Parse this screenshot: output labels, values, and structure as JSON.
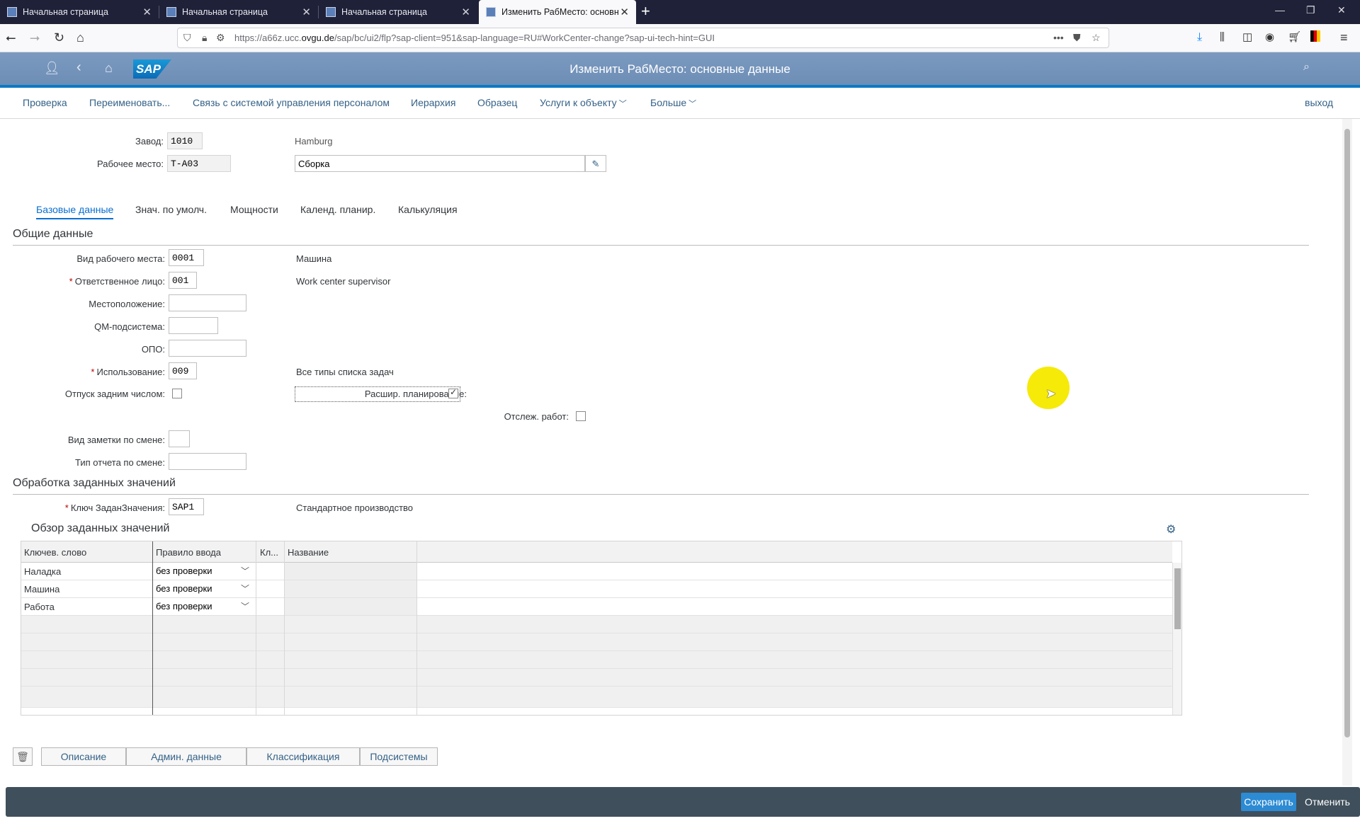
{
  "browser": {
    "tabs": [
      {
        "title": "Начальная страница"
      },
      {
        "title": "Начальная страница"
      },
      {
        "title": "Начальная страница"
      },
      {
        "title": "Изменить РабМесто: основн"
      }
    ],
    "url_prefix": "https://a66z.ucc.",
    "url_domain": "ovgu.de",
    "url_rest": "/sap/bc/ui2/flp?sap-client=951&sap-language=RU#WorkCenter-change?sap-ui-tech-hint=GUI"
  },
  "shell": {
    "title": "Изменить РабМесто: основные данные",
    "logo": "SAP"
  },
  "toolbar": {
    "items": [
      "Проверка",
      "Переименовать...",
      "Связь с системой управления персоналом",
      "Иерархия",
      "Образец",
      "Услуги к объекту",
      "Больше"
    ],
    "exit": "выход"
  },
  "header": {
    "plant_label": "Завод:",
    "plant_value": "1010",
    "plant_name": "Hamburg",
    "wc_label": "Рабочее место:",
    "wc_value": "T-A03",
    "wc_desc": "Сборка"
  },
  "tabs": [
    "Базовые данные",
    "Знач. по умолч.",
    "Мощности",
    "Календ. планир.",
    "Калькуляция"
  ],
  "general": {
    "title": "Общие данные",
    "wc_category_label": "Вид рабочего места:",
    "wc_category_value": "0001",
    "wc_category_text": "Машина",
    "person_label": "Ответственное лицо:",
    "person_value": "001",
    "person_text": "Work center supervisor",
    "location_label": "Местоположение:",
    "qm_label": "QM-подсистема:",
    "opo_label": "ОПО:",
    "usage_label": "Использование:",
    "usage_value": "009",
    "usage_text": "Все типы списка задач",
    "backflush_label": "Отпуск задним числом:",
    "adv_planning_label": "Расшир. планирование:",
    "track_label": "Отслеж. работ:",
    "shift_note_label": "Вид заметки по смене:",
    "shift_report_label": "Тип отчета по смене:"
  },
  "defaults": {
    "title": "Обработка заданных значений",
    "key_label": "Ключ ЗаданЗначения:",
    "key_value": "SAP1",
    "key_text": "Стандартное производство",
    "overview_title": "Обзор заданных значений",
    "columns": [
      "Ключев. слово",
      "Правило ввода",
      "Кл...",
      "Название"
    ],
    "rows": [
      {
        "keyword": "Наладка",
        "rule": "без проверки"
      },
      {
        "keyword": "Машина",
        "rule": "без проверки"
      },
      {
        "keyword": "Работа",
        "rule": "без проверки"
      }
    ]
  },
  "bottom_buttons": [
    "Описание",
    "Админ. данные",
    "Классификация",
    "Подсистемы"
  ],
  "footer": {
    "save": "Сохранить",
    "cancel": "Отменить"
  }
}
